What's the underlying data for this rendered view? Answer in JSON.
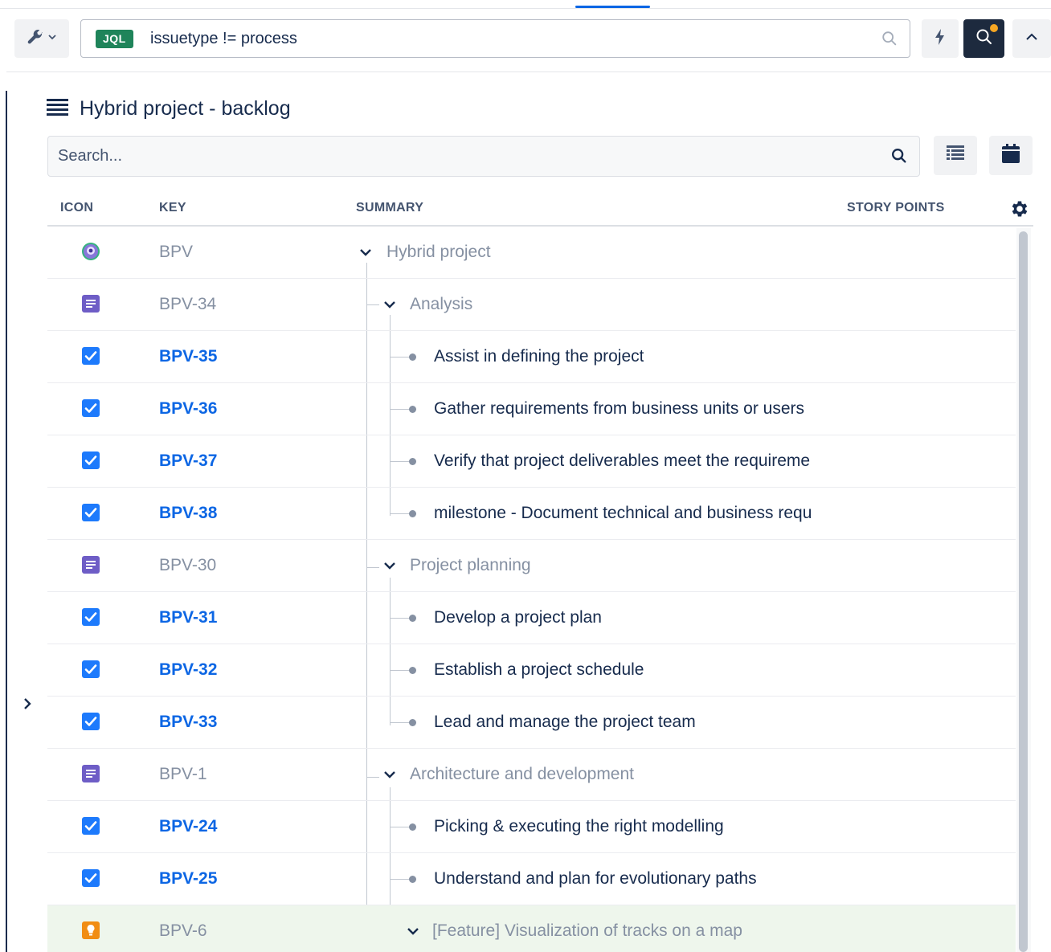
{
  "toolbar": {
    "jql_badge": "JQL",
    "jql_query": "issuetype != process"
  },
  "panel": {
    "title": "Hybrid project - backlog",
    "search_placeholder": "Search..."
  },
  "columns": {
    "icon": "ICON",
    "key": "KEY",
    "summary": "SUMMARY",
    "story_points": "STORY POINTS"
  },
  "rows": [
    {
      "key": "BPV",
      "summary": "Hybrid project",
      "type": "project",
      "level": 0,
      "expanded": true
    },
    {
      "key": "BPV-34",
      "summary": "Analysis",
      "type": "epic",
      "level": 1,
      "expanded": true
    },
    {
      "key": "BPV-35",
      "summary": "Assist in defining the project",
      "type": "task",
      "level": 2
    },
    {
      "key": "BPV-36",
      "summary": "Gather requirements from business units or users",
      "type": "task",
      "level": 2
    },
    {
      "key": "BPV-37",
      "summary": "Verify that project deliverables meet the requireme",
      "type": "task",
      "level": 2
    },
    {
      "key": "BPV-38",
      "summary": "milestone - Document technical and business requ",
      "type": "task",
      "level": 2
    },
    {
      "key": "BPV-30",
      "summary": "Project planning",
      "type": "epic",
      "level": 1,
      "expanded": true
    },
    {
      "key": "BPV-31",
      "summary": "Develop a project plan",
      "type": "task",
      "level": 2
    },
    {
      "key": "BPV-32",
      "summary": "Establish a project schedule",
      "type": "task",
      "level": 2
    },
    {
      "key": "BPV-33",
      "summary": "Lead and manage the project team",
      "type": "task",
      "level": 2
    },
    {
      "key": "BPV-1",
      "summary": "Architecture and development",
      "type": "epic",
      "level": 1,
      "expanded": true
    },
    {
      "key": "BPV-24",
      "summary": "Picking & executing the right modelling",
      "type": "task",
      "level": 2
    },
    {
      "key": "BPV-25",
      "summary": "Understand and plan for evolutionary paths",
      "type": "task",
      "level": 2
    },
    {
      "key": "BPV-6",
      "summary": "[Feature] Visualization of tracks on a map",
      "type": "feature",
      "level": 2,
      "expanded": true,
      "highlighted": true
    }
  ],
  "colors": {
    "link": "#0c66e4",
    "epic": "#6e5dc6",
    "task": "#1d7afc",
    "feature": "#f18d13",
    "jql": "#1f845a"
  }
}
